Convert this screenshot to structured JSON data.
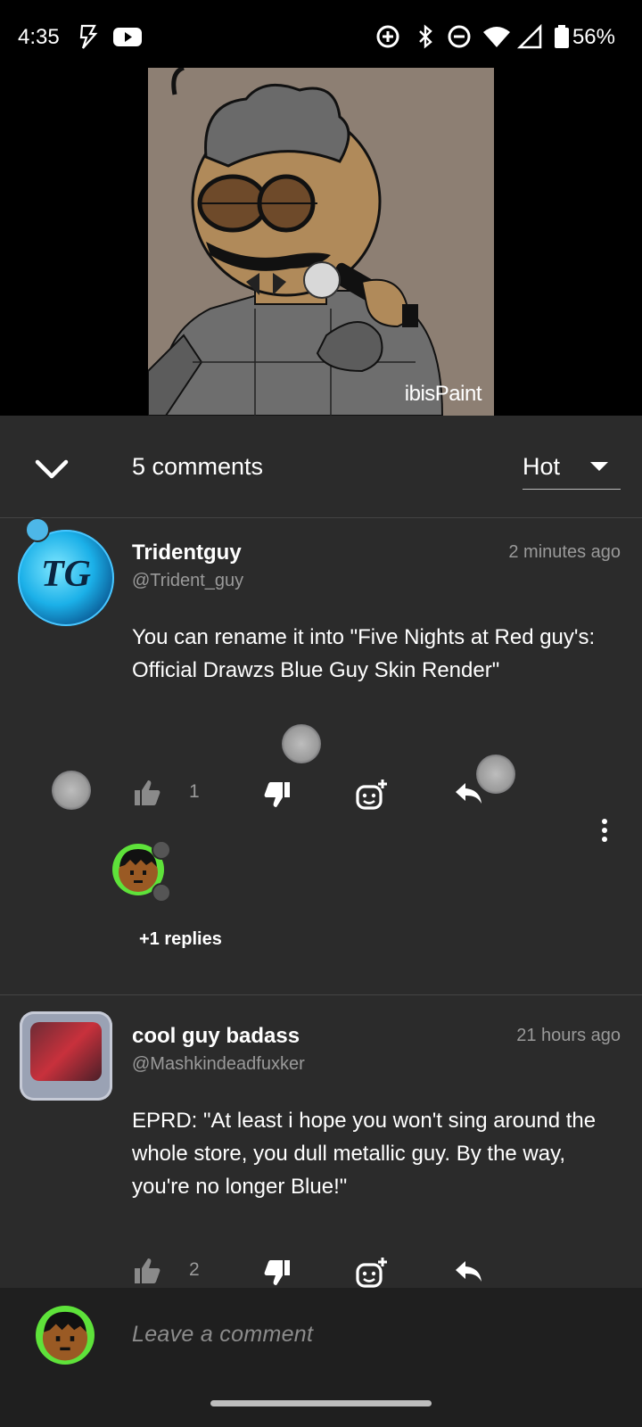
{
  "status_bar": {
    "time": "4:35",
    "battery": "56%",
    "icons": [
      "flash-auto-icon",
      "youtube-icon",
      "data-saver-icon",
      "bluetooth-icon",
      "do-not-disturb-icon",
      "wifi-icon",
      "signal-icon",
      "battery-icon"
    ]
  },
  "media": {
    "watermark": "ibisPaint",
    "background_color": "#8d7f73"
  },
  "comments_header": {
    "count_label": "5 comments",
    "sort_label": "Hot"
  },
  "comments": [
    {
      "username": "Tridentguy",
      "handle": "@Trident_guy",
      "time": "2 minutes ago",
      "avatar_text": "TG",
      "text": "You can rename it into \"Five Nights at Red guy's: Official Drawzs Blue Guy Skin Render\"",
      "likes": "1",
      "replies_label": "+1 replies"
    },
    {
      "username": "cool guy badass",
      "handle": "@Mashkindeadfuxker",
      "time": "21 hours ago",
      "text": "EPRD: \"At least i hope you won't sing around the whole store, you dull metallic guy. By the way, you're no longer Blue!\"",
      "likes": "2"
    }
  ],
  "composer": {
    "placeholder": "Leave a comment"
  },
  "colors": {
    "background": "#2b2b2b",
    "composer": "#1f1f1f",
    "muted_text": "#9a9a9a",
    "avatar_ring": "#5ee23a"
  }
}
